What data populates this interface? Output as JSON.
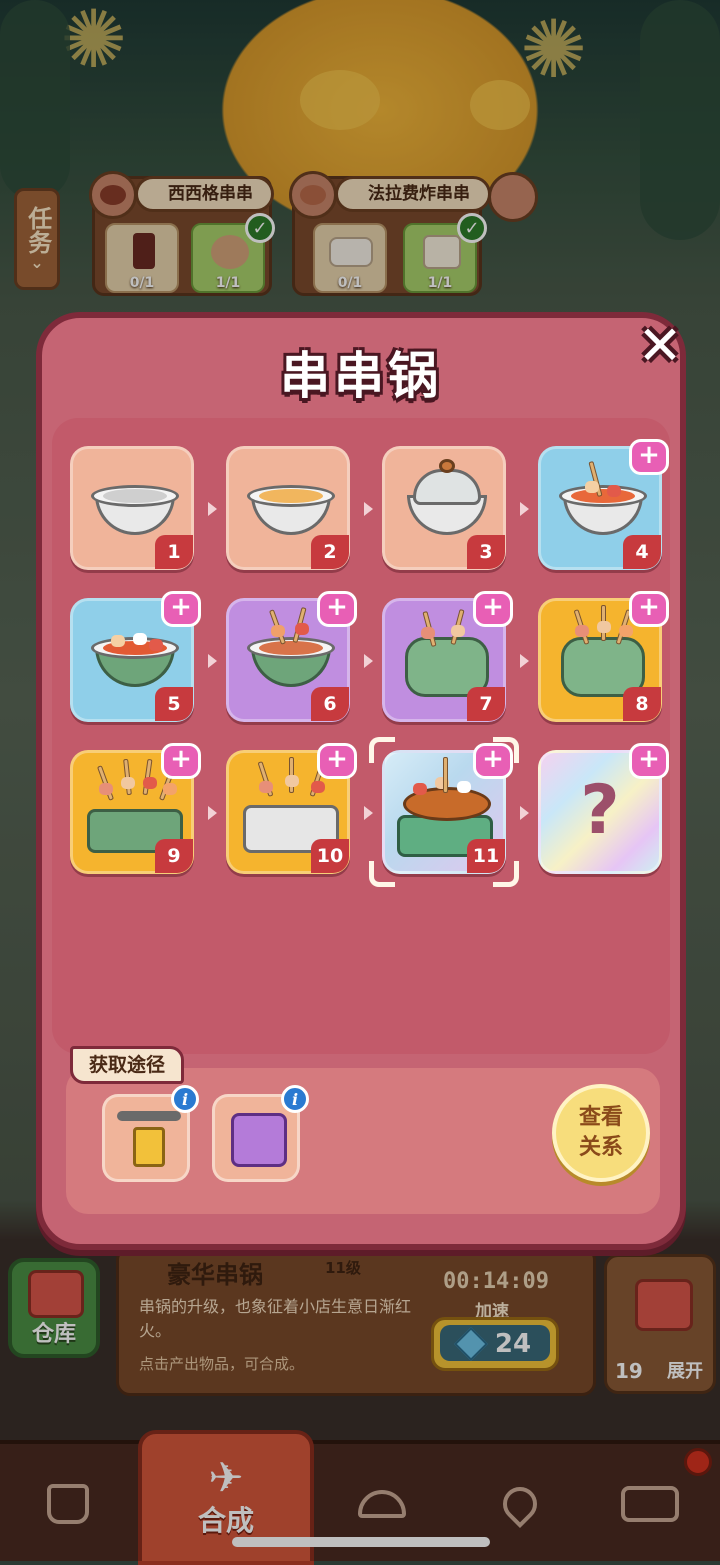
{
  "scene": {
    "task_button_label": "任务",
    "tasks": [
      {
        "title": "西西格串串",
        "slots": [
          {
            "count": "0/1",
            "done": false
          },
          {
            "count": "1/1",
            "done": true
          }
        ]
      },
      {
        "title": "法拉费炸串串",
        "slots": [
          {
            "count": "0/1",
            "done": false
          },
          {
            "count": "1/1",
            "done": true
          }
        ]
      }
    ]
  },
  "modal": {
    "title": "串串锅",
    "close_icon": "close-icon",
    "levels": [
      {
        "level": "1",
        "style": "peach",
        "plus": false
      },
      {
        "level": "2",
        "style": "peach",
        "plus": false
      },
      {
        "level": "3",
        "style": "peach",
        "plus": false
      },
      {
        "level": "4",
        "style": "blue",
        "plus": true
      },
      {
        "level": "5",
        "style": "blue",
        "plus": true
      },
      {
        "level": "6",
        "style": "purple",
        "plus": true
      },
      {
        "level": "7",
        "style": "purple",
        "plus": true
      },
      {
        "level": "8",
        "style": "gold",
        "plus": true
      },
      {
        "level": "9",
        "style": "gold",
        "plus": true
      },
      {
        "level": "10",
        "style": "gold",
        "plus": true
      },
      {
        "level": "11",
        "style": "selected",
        "plus": true
      },
      {
        "level": "",
        "style": "holo",
        "plus": true,
        "unknown": "?"
      }
    ],
    "acquire": {
      "label": "获取途径",
      "sources": [
        {
          "icon": "drone-delivery-icon"
        },
        {
          "icon": "mystery-box-icon"
        }
      ],
      "view_relation_line1": "查看",
      "view_relation_line2": "关系"
    }
  },
  "item_info": {
    "name": "豪华串锅",
    "level": "11级",
    "description": "串锅的升级，也象征着小店生意日渐红火。",
    "hint": "点击产出物品，可合成。",
    "timer": "00:14:09",
    "speed_label": "加速",
    "speed_cost": "24"
  },
  "warehouse_label": "仓库",
  "expand": {
    "count": "19",
    "label": "展开"
  },
  "bottom_nav": {
    "active_label": "合成",
    "items": [
      "shop-bag-icon",
      "merge-icon",
      "service-bell-icon",
      "map-pin-icon",
      "bus-icon"
    ]
  },
  "colors": {
    "modal_bg": "#c56473",
    "modal_border": "#7e2a3a",
    "accent_pink": "#e85fb5",
    "badge_red": "#c73a3e"
  }
}
